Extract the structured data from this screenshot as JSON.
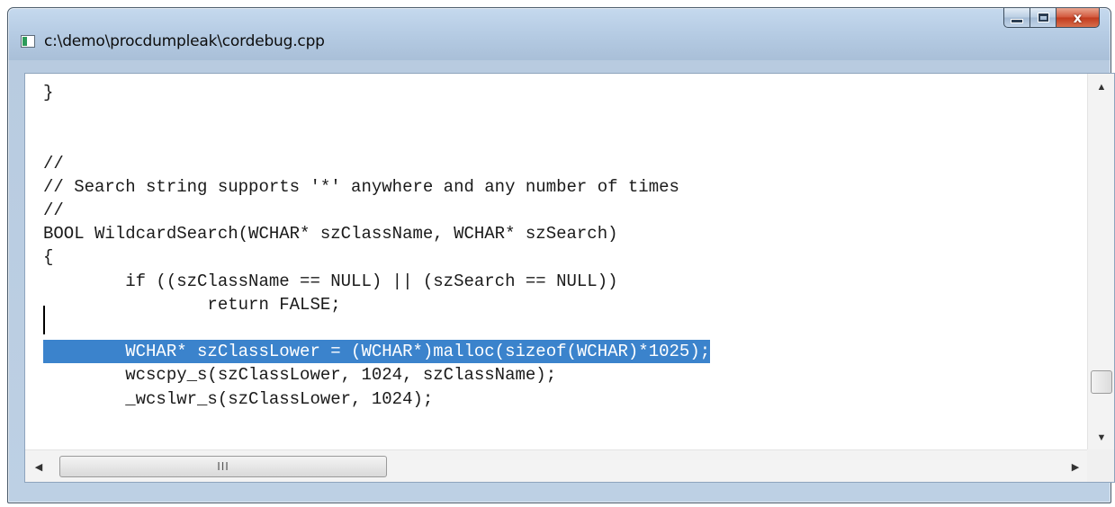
{
  "window": {
    "title": "c:\\demo\\procdumpleak\\cordebug.cpp",
    "app_icon": "window-app-icon",
    "buttons": {
      "minimize_icon": "minimize-icon",
      "maximize_icon": "maximize-icon",
      "close_icon": "close-icon"
    },
    "colors": {
      "selection": "#3b83cc",
      "close_button": "#c13a1d"
    }
  },
  "editor": {
    "lines": [
      "}",
      "",
      "",
      "//",
      "// Search string supports '*' anywhere and any number of times",
      "//",
      "BOOL WildcardSearch(WCHAR* szClassName, WCHAR* szSearch)",
      "{",
      "        if ((szClassName == NULL) || (szSearch == NULL))",
      "                return FALSE;",
      "",
      "        WCHAR* szClassLower = (WCHAR*)malloc(sizeof(WCHAR)*1025);",
      "        wcscpy_s(szClassLower, 1024, szClassName);",
      "        _wcslwr_s(szClassLower, 1024);"
    ],
    "selected_line_index": 11
  },
  "scrollbars": {
    "vertical": {
      "up_arrow": "▲",
      "down_arrow": "▼"
    },
    "horizontal": {
      "left_arrow": "◀",
      "right_arrow": "▶",
      "grip": "III"
    }
  }
}
